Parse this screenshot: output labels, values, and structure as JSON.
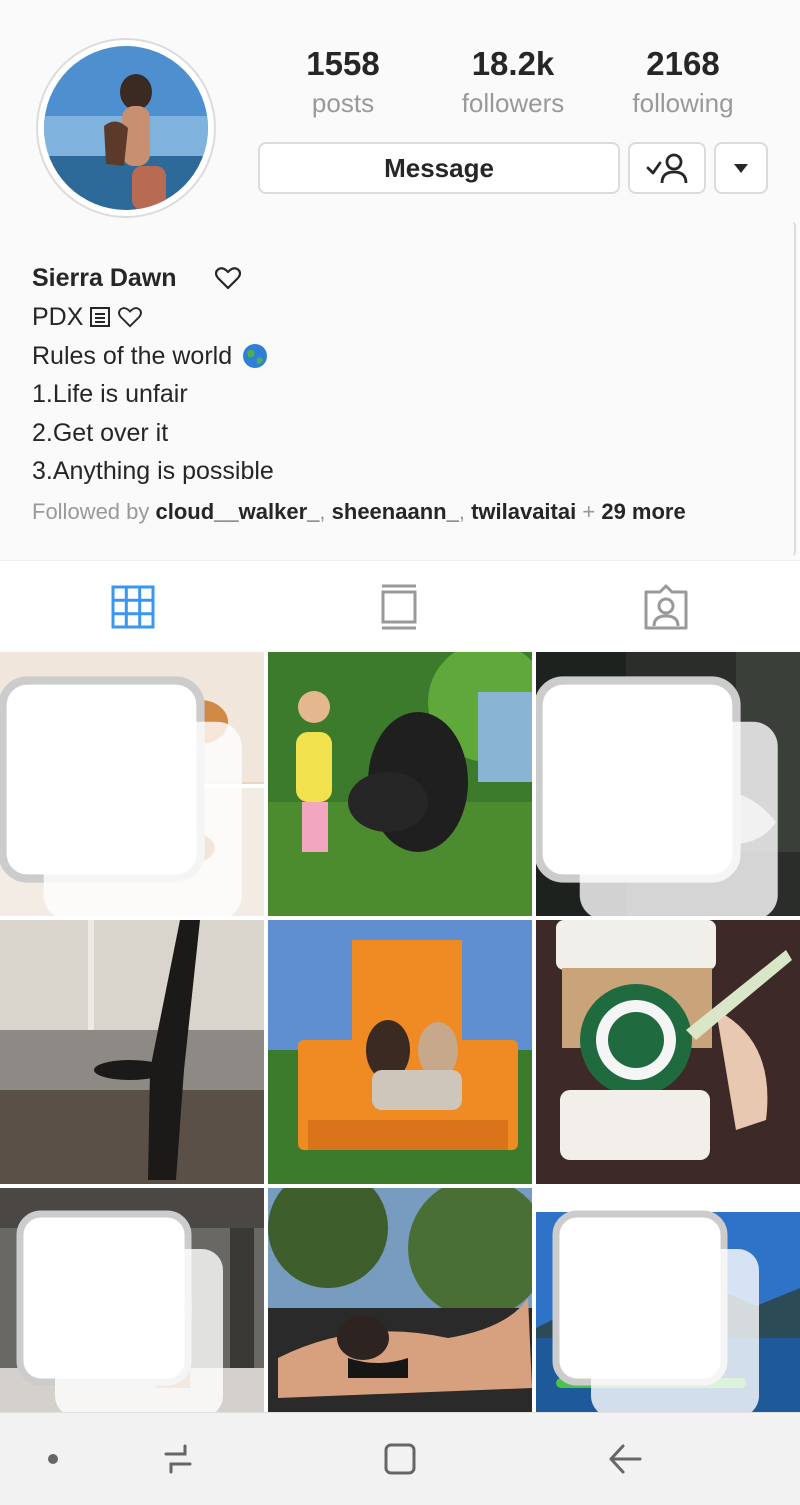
{
  "profile": {
    "stats": [
      {
        "value": "1558",
        "label": "posts"
      },
      {
        "value": "18.2k",
        "label": "followers"
      },
      {
        "value": "2168",
        "label": "following"
      }
    ],
    "message_label": "Message",
    "name": "Sierra Dawn",
    "bio_lines": [
      "PDX",
      "Rules of the world",
      "1.Life is unfair",
      "2.Get over it",
      "3.Anything is possible"
    ],
    "followed_by": {
      "prefix": "Followed by",
      "users": [
        "cloud__walker_",
        "sheenaann_",
        "twilavaitai"
      ],
      "separator": ",",
      "plus": "+",
      "more": "29 more"
    }
  },
  "tabs": [
    "grid-view",
    "feed-view",
    "tagged-view"
  ],
  "grid": {
    "posts": [
      {
        "description": "orange cat on bed",
        "multi": true
      },
      {
        "description": "girl with dog in garden",
        "multi": false
      },
      {
        "description": "mirror selfie",
        "multi": true
      },
      {
        "description": "beach handstand",
        "multi": false
      },
      {
        "description": "family on giant chair",
        "multi": false
      },
      {
        "description": "coffee cup",
        "multi": false
      },
      {
        "description": "pier swimsuit",
        "multi": true
      },
      {
        "description": "sunbathing",
        "multi": false
      },
      {
        "description": "kayak on lake",
        "multi": true
      }
    ]
  },
  "colors": {
    "accent": "#3897f0",
    "text": "#262626",
    "muted": "#999999",
    "border": "#dbdbdb",
    "background": "#fafafa"
  },
  "nav": [
    "dot-icon",
    "recent-apps-icon",
    "home-icon",
    "back-icon"
  ]
}
